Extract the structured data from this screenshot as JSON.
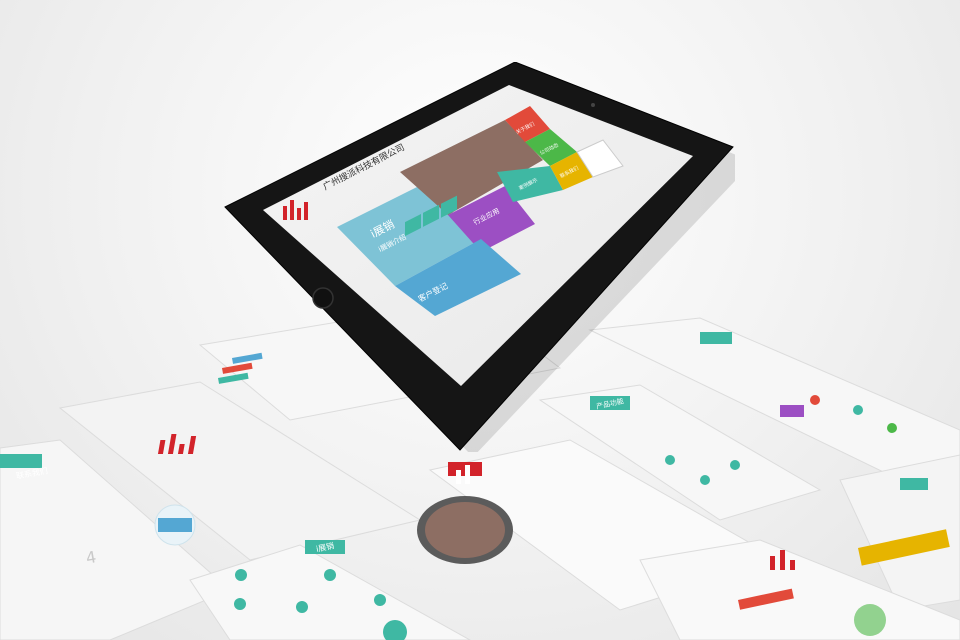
{
  "company": {
    "name": "广州搜派科技有限公司"
  },
  "tiles": {
    "about": "关于我们",
    "wechat": "公司动态",
    "cases": "案例展示",
    "events": "联系我们",
    "industry": "行业应用",
    "big_brand": "i展销",
    "big_sub": "i展销介绍",
    "customer": "客户登记"
  },
  "colors": {
    "teal": "#3fb8a3",
    "lightblue": "#7ec3d6",
    "purple": "#9c4fc3",
    "green": "#4cb848",
    "yellow": "#e6b400",
    "red": "#e24a3a",
    "blue": "#54a7d3",
    "brand_red": "#d2232a",
    "tablet_body": "#151515"
  },
  "cards": {
    "contact_label": "联系我们",
    "brand_label": "i展销",
    "ineed_label": "i展销介绍",
    "product_label": "产品功能",
    "page_number": "4"
  },
  "icons": [
    "menu-icon",
    "share-icon",
    "grid-icon",
    "home-button-icon"
  ]
}
